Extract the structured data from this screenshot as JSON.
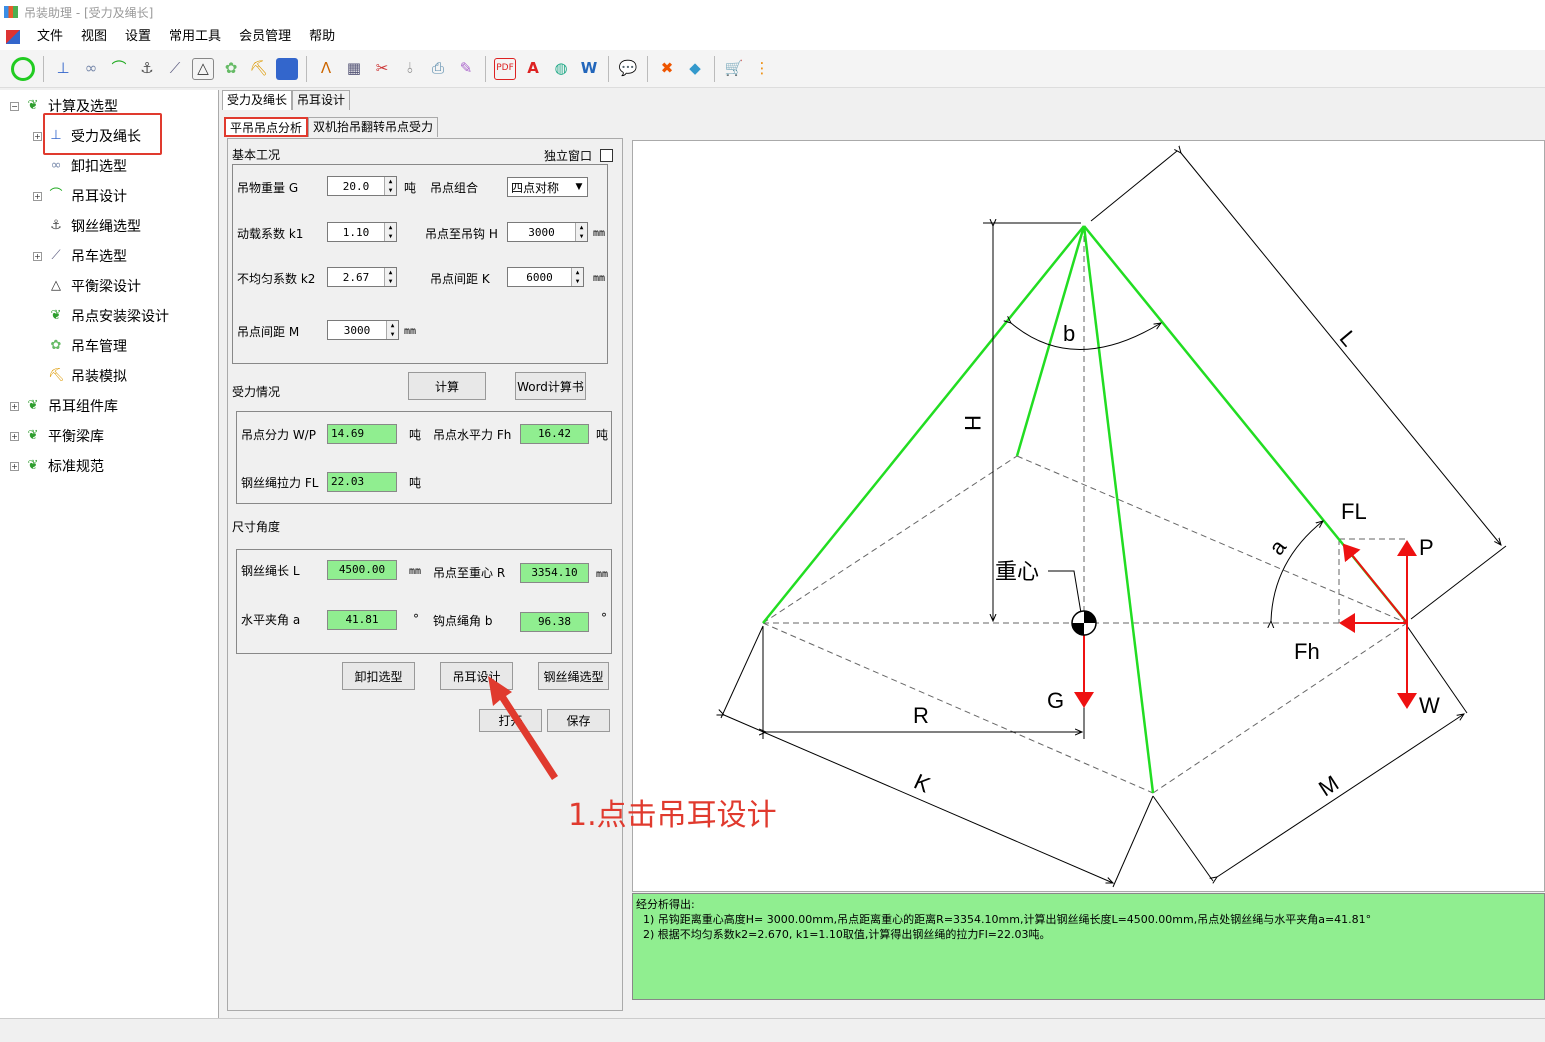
{
  "window": {
    "title": "吊装助理 - [受力及绳长]"
  },
  "menu": [
    "文件",
    "视图",
    "设置",
    "常用工具",
    "会员管理",
    "帮助"
  ],
  "toolbar": {
    "icons": [
      "circle-icon",
      "axis-icon",
      "shackle-icon",
      "lug-icon",
      "sling-icon",
      "crane-icon",
      "beam-icon",
      "flower-icon",
      "excavator-icon",
      "box-icon",
      "compass-icon",
      "calculator-icon",
      "scissors-icon",
      "ruler-icon",
      "printer-icon",
      "pen-icon",
      "pdf-icon",
      "text-a-icon",
      "globe-icon",
      "word-icon",
      "chat-icon",
      "tools-icon",
      "eraser-icon",
      "cart-icon",
      "settings-icon"
    ]
  },
  "tree": {
    "root1": "计算及选型",
    "children": [
      "受力及绳长",
      "卸扣选型",
      "吊耳设计",
      "钢丝绳选型",
      "吊车选型",
      "平衡梁设计",
      "吊点安装梁设计",
      "吊车管理",
      "吊装模拟"
    ],
    "root2": "吊耳组件库",
    "root3": "平衡梁库",
    "root4": "标准规范"
  },
  "tabs_top": [
    "受力及绳长",
    "吊耳设计"
  ],
  "tabs_sub": [
    "平吊吊点分析",
    "双机抬吊翻转吊点受力"
  ],
  "basic": {
    "group": "基本工况",
    "standalone": "独立窗口",
    "weight_label": "吊物重量 G",
    "weight": "20.0",
    "weight_unit": "吨",
    "combo_label": "吊点组合",
    "combo_value": "四点对称",
    "k1_label": "动载系数 k1",
    "k1": "1.10",
    "hook_label": "吊点至吊钩 H",
    "hook": "3000",
    "hook_unit": "mm",
    "k2_label": "不均匀系数 k2",
    "k2": "2.67",
    "spacing_k_label": "吊点间距 K",
    "spacing_k": "6000",
    "spacing_k_unit": "mm",
    "spacing_m_label": "吊点间距 M",
    "spacing_m": "3000",
    "spacing_m_unit": "mm"
  },
  "buttons": {
    "calc": "计算",
    "word": "Word计算书",
    "shackle": "卸扣选型",
    "lug": "吊耳设计",
    "rope": "钢丝绳选型",
    "open": "打开",
    "save": "保存"
  },
  "force": {
    "group": "受力情况",
    "wp_label": "吊点分力 W/P",
    "wp": "14.69",
    "wp_unit": "吨",
    "fh_label": "吊点水平力 Fh",
    "fh": "16.42",
    "fh_unit": "吨",
    "fl_label": "钢丝绳拉力 FL",
    "fl": "22.03",
    "fl_unit": "吨"
  },
  "dims": {
    "group": "尺寸角度",
    "l_label": "钢丝绳长 L",
    "l": "4500.00",
    "l_unit": "mm",
    "r_label": "吊点至重心 R",
    "r": "3354.10",
    "r_unit": "mm",
    "a_label": "水平夹角 a",
    "a": "41.81",
    "a_unit": "°",
    "b_label": "钩点绳角 b",
    "b": "96.38",
    "b_unit": "°"
  },
  "diagram_labels": {
    "H": "H",
    "b": "b",
    "L": "L",
    "FL": "FL",
    "P": "P",
    "a": "a",
    "Fh": "Fh",
    "G": "G",
    "R": "R",
    "W": "W",
    "K": "K",
    "M": "M",
    "cog": "重心"
  },
  "result": {
    "lines": [
      "经分析得出:",
      "  1) 吊钩距离重心高度H= 3000.00mm,吊点距离重心的距离R=3354.10mm,计算出钢丝绳长度L=4500.00mm,吊点处钢丝绳与水平夹角a=41.81°",
      "  2) 根据不均匀系数k2=2.670, k1=1.10取值,计算得出钢丝绳的拉力Fl=22.03吨。"
    ]
  },
  "annotation": "1.点击吊耳设计",
  "colors": {
    "highlight": "#e03a2e",
    "sling": "#22dd22",
    "force": "#ee1111",
    "output_bg": "#90ee90"
  }
}
